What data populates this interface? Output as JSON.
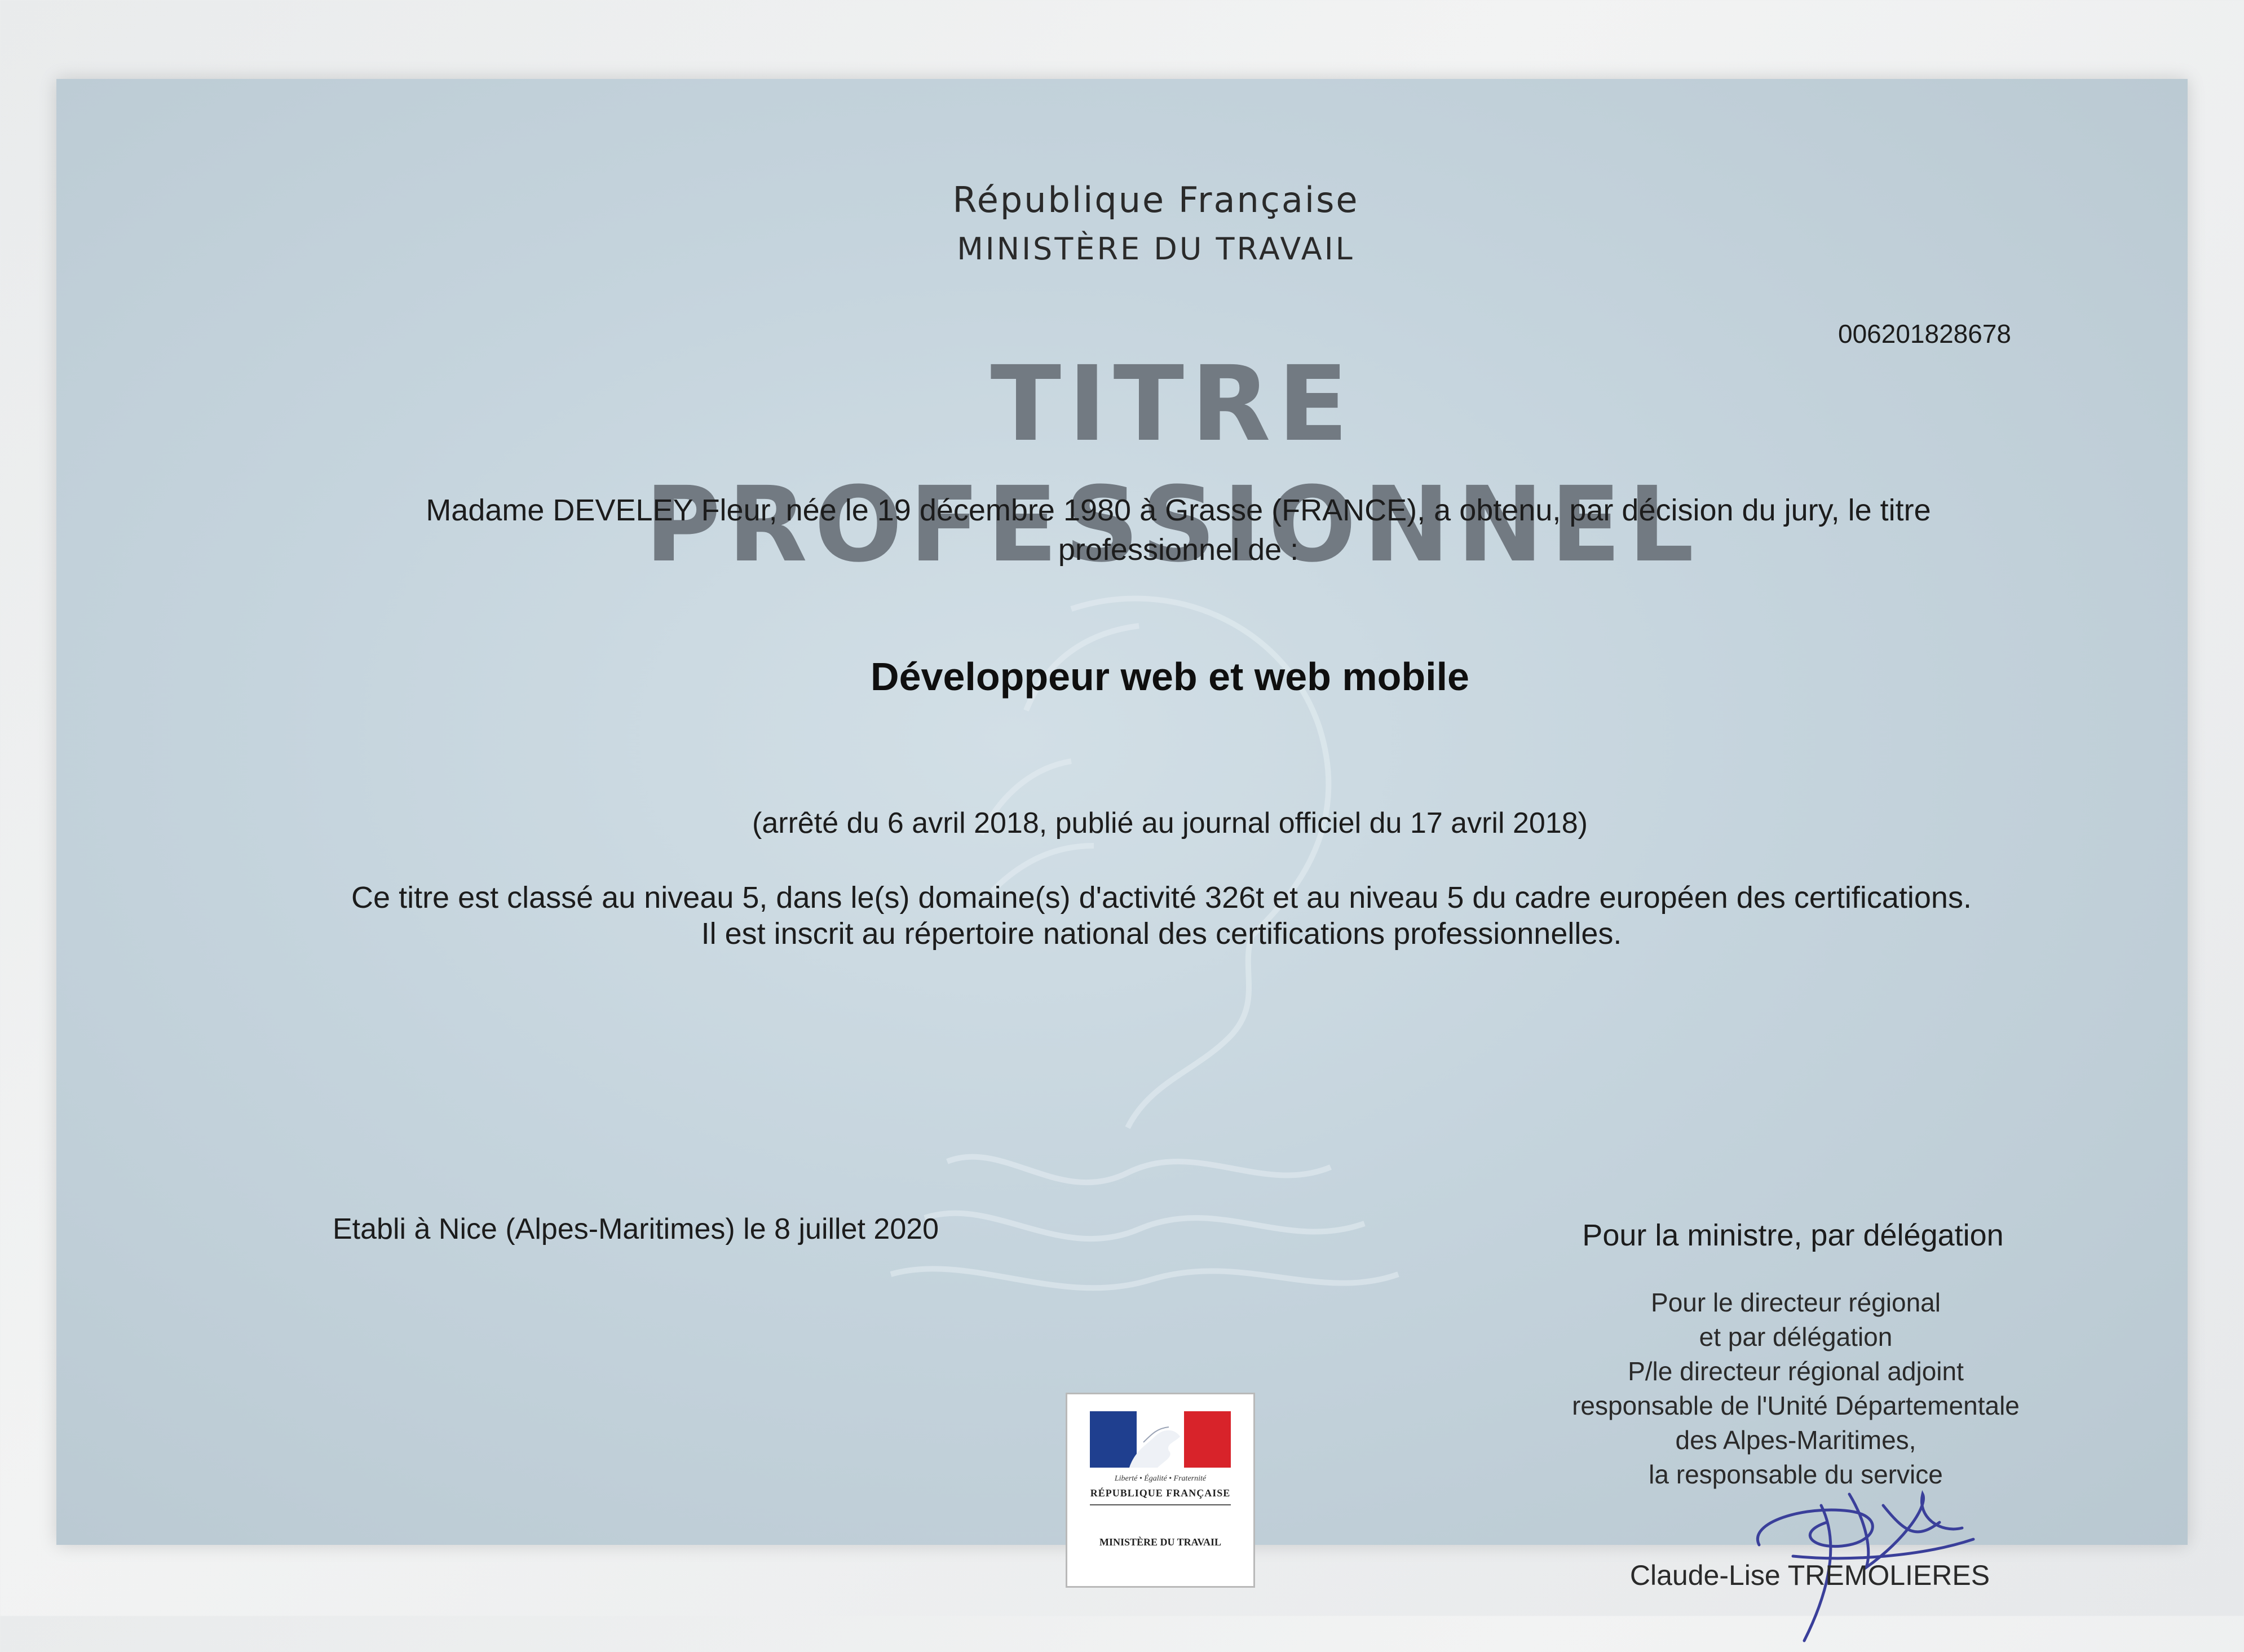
{
  "header": {
    "republique": "République Française",
    "ministere": "MINISTÈRE DU TRAVAIL",
    "numero": "006201828678",
    "titre": "TITRE PROFESSIONNEL"
  },
  "body": {
    "intro": "Madame DEVELEY Fleur, née le 19 décembre 1980 à Grasse (FRANCE), a obtenu, par décision du jury, le titre professionnel de :",
    "titre_obtenu": "Développeur web et web mobile",
    "arrete": "(arrêté du 6 avril 2018, publié au journal officiel du 17 avril 2018)",
    "classe_1": "Ce titre est classé au niveau 5, dans le(s) domaine(s) d'activité 326t et au niveau 5 du cadre européen des certifications.",
    "classe_2": "Il est inscrit au répertoire national des certifications professionnelles."
  },
  "footer": {
    "etabli": "Etabli à Nice (Alpes-Maritimes) le 8 juillet 2020",
    "pour_ministre": "Pour la ministre, par délégation",
    "delegation": [
      "Pour le directeur régional",
      "et par délégation",
      "P/le directeur régional adjoint",
      "responsable de l'Unité Départementale",
      "des Alpes-Maritimes,",
      "la responsable du service"
    ],
    "signataire": "Claude-Lise TREMOLIERES"
  },
  "logo": {
    "motto": "Liberté • Égalité • Fraternité",
    "republique": "RÉPUBLIQUE FRANÇAISE",
    "ministere": "MINISTÈRE DU TRAVAIL",
    "colors": {
      "blue": "#1f3f8f",
      "red": "#d8232a"
    }
  }
}
